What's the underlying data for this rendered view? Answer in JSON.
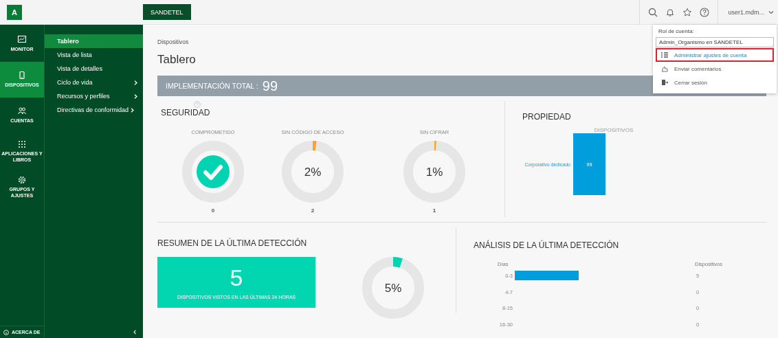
{
  "topbar": {
    "logo": "A",
    "org_button": "SANDETEL",
    "user": "user1.mdm..."
  },
  "account_menu": {
    "role_label": "Rol de cuenta:",
    "role": "Admin_Organismo en SANDETEL",
    "items": [
      {
        "label": "Administrar ajustes de cuenta",
        "selected": true
      },
      {
        "label": "Enviar comentarios",
        "selected": false
      },
      {
        "label": "Cerrar sesión",
        "selected": false
      }
    ]
  },
  "rail": {
    "items": [
      {
        "label": "MONITOR",
        "selected": false
      },
      {
        "label": "DISPOSITIVOS",
        "selected": true
      },
      {
        "label": "CUENTAS",
        "selected": false
      },
      {
        "label": "APLICACIONES Y LIBROS",
        "selected": false
      },
      {
        "label": "GRUPOS Y AJUSTES",
        "selected": false
      }
    ],
    "footer": "ACERCA DE"
  },
  "subnav": {
    "items": [
      {
        "label": "Tablero",
        "selected": true,
        "has_submenu": false
      },
      {
        "label": "Vista de lista",
        "selected": false,
        "has_submenu": false
      },
      {
        "label": "Vista de detalles",
        "selected": false,
        "has_submenu": false
      },
      {
        "label": "Ciclo de vida",
        "selected": false,
        "has_submenu": true
      },
      {
        "label": "Recursos y perfiles",
        "selected": false,
        "has_submenu": true
      },
      {
        "label": "Directivas de conformidad",
        "selected": false,
        "has_submenu": true
      }
    ]
  },
  "breadcrumb": "Dispositivos",
  "title": "Tablero",
  "total_bar": {
    "label": "IMPLEMENTACIÓN TOTAL :",
    "value": "99"
  },
  "security": {
    "title": "SEGURIDAD",
    "items": [
      {
        "kind": "check",
        "label": "COMPROMETIDO",
        "count": "0"
      },
      {
        "kind": "donut",
        "label": "SIN CÓDIGO DE ACCESO",
        "percent": "2%",
        "level": 0.02,
        "count": "2"
      },
      {
        "kind": "donut",
        "label": "SIN CIFRAR",
        "percent": "1%",
        "level": 0.01,
        "count": "1"
      }
    ]
  },
  "ownership": {
    "title": "PROPIEDAD",
    "column_label": "DISPOSITIVOS",
    "bars": [
      {
        "label": "Corporativo dedicado",
        "value": "99"
      }
    ]
  },
  "summary": {
    "title": "RESUMEN DE LA ÚLTIMA DETECCIÓN",
    "count": "5",
    "caption": "DISPOSITIVOS VISTOS EN LAS ÚLTIMAS 24 HORAS",
    "percent": "5%",
    "level": 0.05
  },
  "analysis": {
    "title": "ANÁLISIS DE LA ÚLTIMA DETECCIÓN",
    "value_header": "Dispositivos",
    "chart_data": {
      "type": "bar",
      "orientation": "horizontal",
      "ylabel": "Días",
      "categories": [
        "0-3",
        "4-7",
        "8-15",
        "16-30"
      ],
      "values": [
        5,
        0,
        0,
        0
      ],
      "data_labels": true
    }
  }
}
